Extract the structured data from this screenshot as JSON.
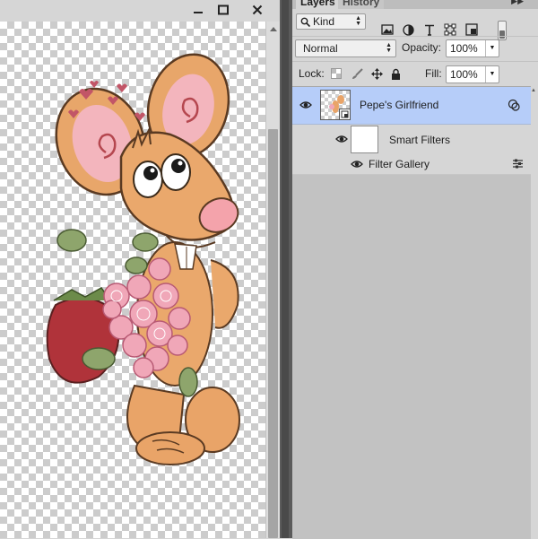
{
  "document": {
    "buttons": {
      "minimize": "minimize",
      "maximize": "maximize",
      "close": "close"
    }
  },
  "panel": {
    "tabs": [
      {
        "label": "Layers",
        "active": true
      },
      {
        "label": "History",
        "active": false
      }
    ],
    "filter": {
      "kind_label": "Kind",
      "icons": [
        "image-filter-icon",
        "adjustment-filter-icon",
        "type-filter-icon",
        "shape-filter-icon",
        "smart-object-filter-icon"
      ]
    },
    "blend_mode": "Normal",
    "opacity_label": "Opacity:",
    "opacity_value": "100%",
    "lock_label": "Lock:",
    "fill_label": "Fill:",
    "fill_value": "100%",
    "layers": [
      {
        "name": "Pepe's Girlfriend",
        "selected": true,
        "visible": true,
        "type": "smart-object"
      }
    ],
    "smart_filters_label": "Smart Filters",
    "filters": [
      "Filter Gallery"
    ]
  },
  "colors": {
    "selection": "#b6cdf9",
    "panel": "#d6d6d6",
    "list": "#c2c2c2"
  }
}
